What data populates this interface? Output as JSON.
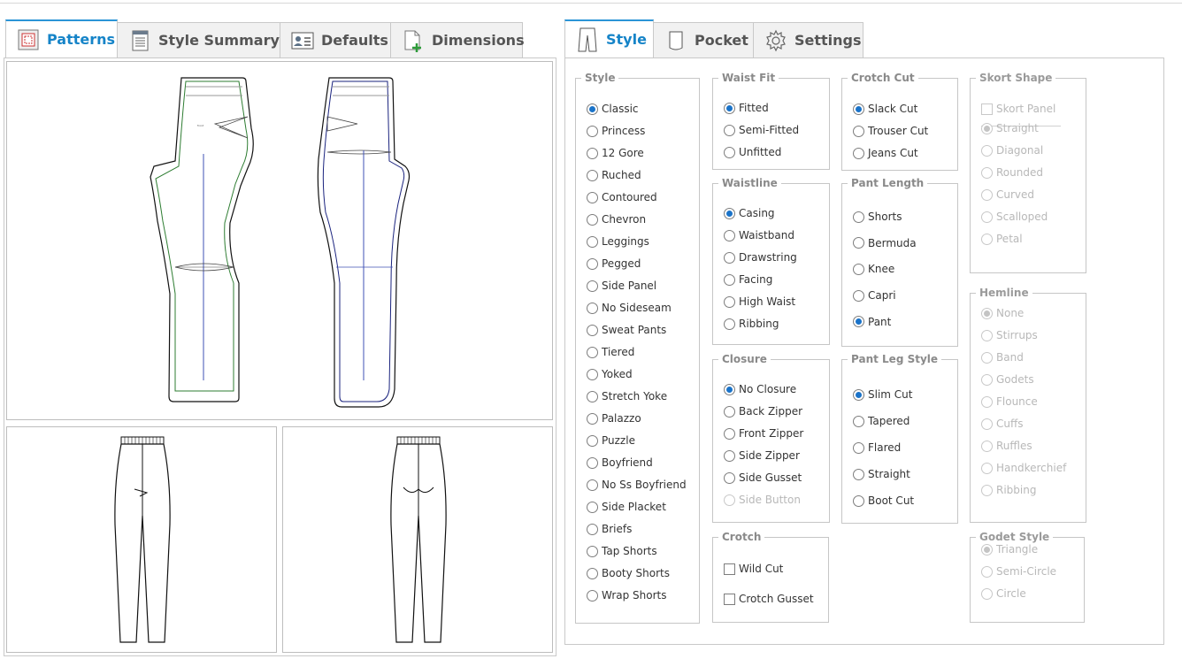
{
  "left_tabs": [
    {
      "label": "Patterns",
      "icon": "patterns-icon",
      "active": true
    },
    {
      "label": "Style Summary",
      "icon": "document-icon",
      "active": false
    },
    {
      "label": "Defaults",
      "icon": "user-card-icon",
      "active": false
    },
    {
      "label": "Dimensions",
      "icon": "add-document-icon",
      "active": false
    }
  ],
  "right_tabs": [
    {
      "label": "Style",
      "icon": "pants-icon",
      "active": true
    },
    {
      "label": "Pocket",
      "icon": "pocket-icon",
      "active": false
    },
    {
      "label": "Settings",
      "icon": "gear-icon",
      "active": false
    }
  ],
  "colors": {
    "accent": "#1684c8",
    "pattern_front": "#2e7d32",
    "pattern_back": "#1a237e",
    "guide_line": "#3f51b5"
  },
  "style": {
    "legend": "Style",
    "selected": "Classic",
    "options": [
      "Classic",
      "Princess",
      "12 Gore",
      "Ruched",
      "Contoured",
      "Chevron",
      "Leggings",
      "Pegged",
      "Side Panel",
      "No Sideseam",
      "Sweat Pants",
      "Tiered",
      "Yoked",
      "Stretch Yoke",
      "Palazzo",
      "Puzzle",
      "Boyfriend",
      "No Ss Boyfriend",
      "Side Placket",
      "Briefs",
      "Tap Shorts",
      "Booty Shorts",
      "Wrap Shorts"
    ]
  },
  "waist_fit": {
    "legend": "Waist Fit",
    "selected": "Fitted",
    "options": [
      "Fitted",
      "Semi-Fitted",
      "Unfitted"
    ]
  },
  "waistline": {
    "legend": "Waistline",
    "selected": "Casing",
    "options": [
      "Casing",
      "Waistband",
      "Drawstring",
      "Facing",
      "High Waist",
      "Ribbing"
    ]
  },
  "closure": {
    "legend": "Closure",
    "selected": "No Closure",
    "options": [
      "No Closure",
      "Back Zipper",
      "Front Zipper",
      "Side Zipper",
      "Side Gusset",
      "Side Button"
    ],
    "disabled": [
      "Side Button"
    ]
  },
  "crotch": {
    "legend": "Crotch",
    "checks": [
      {
        "label": "Wild Cut",
        "checked": false
      },
      {
        "label": "Crotch Gusset",
        "checked": false
      }
    ]
  },
  "crotch_cut": {
    "legend": "Crotch Cut",
    "selected": "Slack Cut",
    "options": [
      "Slack Cut",
      "Trouser Cut",
      "Jeans Cut"
    ]
  },
  "pant_length": {
    "legend": "Pant Length",
    "selected": "Pant",
    "options": [
      "Shorts",
      "Bermuda",
      "Knee",
      "Capri",
      "Pant"
    ]
  },
  "pant_leg_style": {
    "legend": "Pant Leg Style",
    "selected": "Slim Cut",
    "options": [
      "Slim Cut",
      "Tapered",
      "Flared",
      "Straight",
      "Boot Cut"
    ]
  },
  "skort_shape": {
    "legend": "Skort Shape",
    "panel_label": "Skort Panel",
    "selected": "Straight",
    "options": [
      "Straight",
      "Diagonal",
      "Rounded",
      "Curved",
      "Scalloped",
      "Petal"
    ]
  },
  "hemline": {
    "legend": "Hemline",
    "selected": "None",
    "options": [
      "None",
      "Stirrups",
      "Band",
      "Godets",
      "Flounce",
      "Cuffs",
      "Ruffles",
      "Handkerchief",
      "Ribbing"
    ]
  },
  "godet_style": {
    "legend": "Godet Style",
    "selected": "Triangle",
    "options": [
      "Triangle",
      "Semi-Circle",
      "Circle"
    ]
  }
}
